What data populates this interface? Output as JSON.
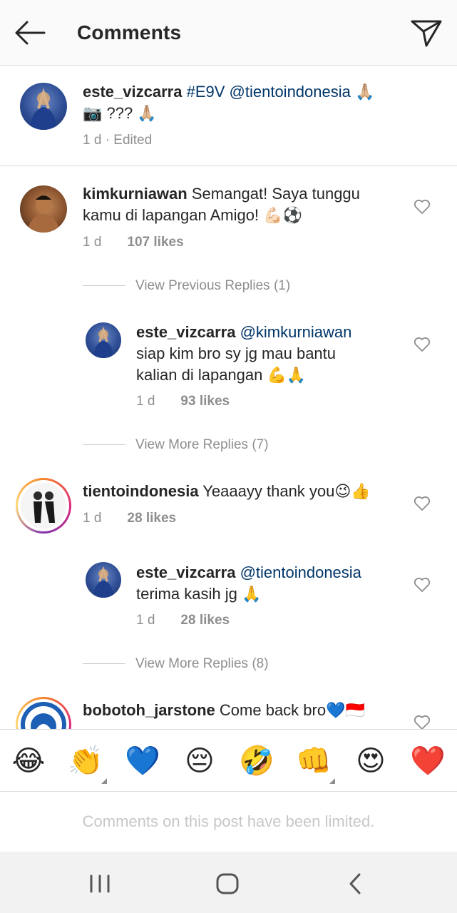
{
  "header": {
    "title": "Comments"
  },
  "caption": {
    "username": "este_vizcarra",
    "hashtag": "#E9V",
    "mention": "@tientoindonesia",
    "emoji1": "🙏🏼",
    "line2": "📷 ??? 🙏🏼",
    "meta": "1 d · Edited"
  },
  "comments": [
    {
      "username": "kimkurniawan",
      "text_line1": "Semangat! Saya tunggu",
      "text_line2": "kamu di lapangan Amigo! 💪🏻⚽",
      "time": "1 d",
      "likes": "107 likes",
      "previous_replies": "View Previous Replies (1)",
      "reply": {
        "username": "este_vizcarra",
        "mention": "@kimkurniawan",
        "text_line1": "siap kim bro sy jg mau bantu",
        "text_line2": "kalian di lapangan 💪🙏",
        "time": "1 d",
        "likes": "93 likes"
      },
      "more_replies": "View More Replies (7)"
    },
    {
      "username": "tientoindonesia",
      "text": "Yeaaayy thank you😉👍",
      "time": "1 d",
      "likes": "28 likes",
      "reply": {
        "username": "este_vizcarra",
        "mention": "@tientoindonesia",
        "text": "terima kasih jg 🙏",
        "time": "1 d",
        "likes": "28 likes"
      },
      "more_replies": "View More Replies (8)"
    },
    {
      "username": "bobotoh_jarstone",
      "text": "Come back bro💙🇮🇩"
    }
  ],
  "emoji_bar": [
    "😂",
    "👏",
    "💙",
    "😔",
    "🤣",
    "👊",
    "😍",
    "❤️"
  ],
  "footer": {
    "limited_text": "Comments on this post have been limited."
  },
  "colors": {
    "mention_blue": "#003569",
    "meta_gray": "#8e8e8e",
    "divider": "#dbdbdb"
  }
}
